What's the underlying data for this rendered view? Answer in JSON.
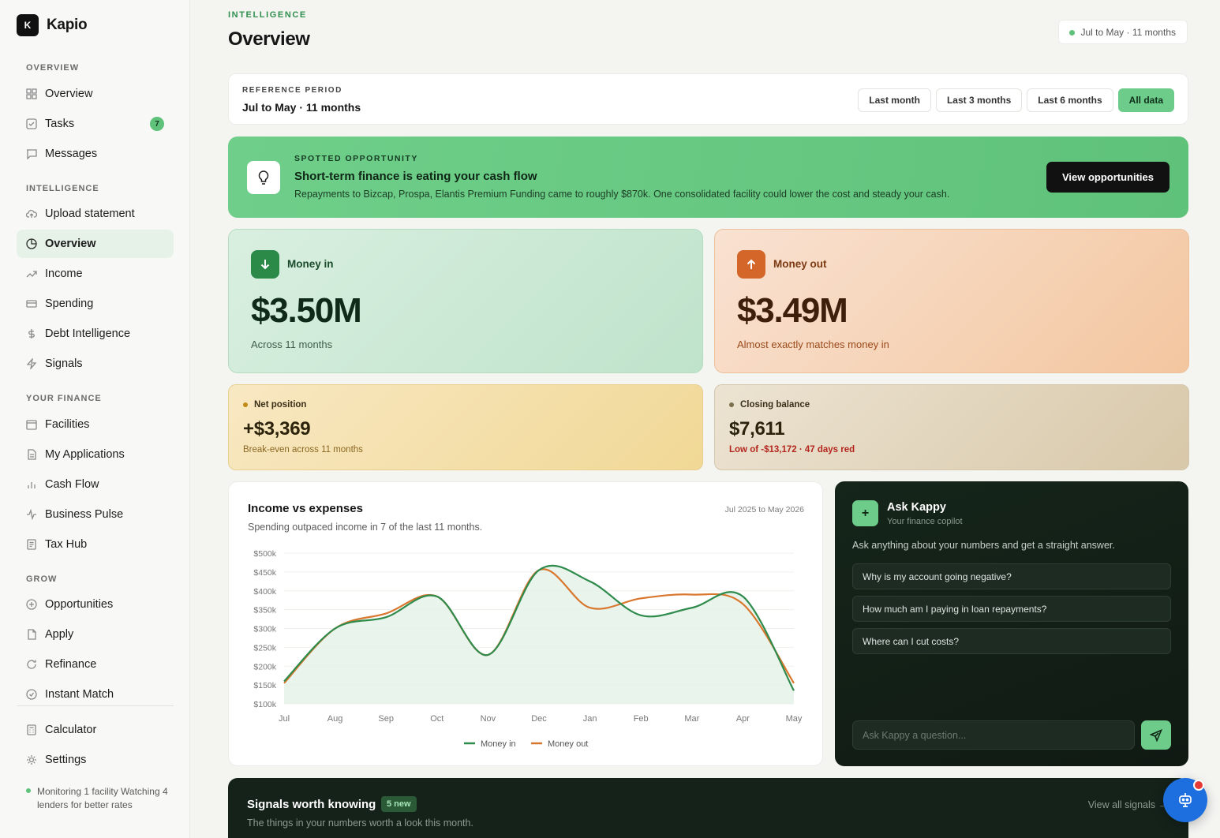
{
  "brand": {
    "logo_letter": "K",
    "name": "Kapio"
  },
  "sidebar": {
    "sections": {
      "overview": "OVERVIEW",
      "intelligence": "INTELLIGENCE",
      "your_finance": "YOUR FINANCE",
      "grow": "GROW"
    },
    "items": {
      "overview_top": "Overview",
      "tasks": "Tasks",
      "tasks_count": "7",
      "messages": "Messages",
      "upload": "Upload statement",
      "overview": "Overview",
      "income": "Income",
      "spending": "Spending",
      "debt": "Debt Intelligence",
      "signals": "Signals",
      "facilities": "Facilities",
      "applications": "My Applications",
      "cashflow": "Cash Flow",
      "pulse": "Business Pulse",
      "tax": "Tax Hub",
      "opportunities": "Opportunities",
      "apply": "Apply",
      "refinance": "Refinance",
      "instant": "Instant Match",
      "calculator": "Calculator",
      "settings": "Settings"
    },
    "monitoring": "Monitoring 1 facility Watching 4 lenders for better rates"
  },
  "header": {
    "eyebrow": "INTELLIGENCE",
    "title": "Overview",
    "period_pill": "Jul to May · 11 months"
  },
  "reference": {
    "label": "REFERENCE PERIOD",
    "value": "Jul to May · 11 months",
    "buttons": [
      "Last month",
      "Last 3 months",
      "Last 6 months",
      "All data"
    ],
    "selected": "All data"
  },
  "opportunity": {
    "eyebrow": "SPOTTED OPPORTUNITY",
    "title": "Short-term finance is eating your cash flow",
    "description": "Repayments to Bizcap, Prospa, Elantis Premium Funding came to roughly $870k. One consolidated facility could lower the cost and steady your cash.",
    "button": "View opportunities"
  },
  "money_in": {
    "label": "Money in",
    "value": "$3.50M",
    "sub": "Across 11 months"
  },
  "money_out": {
    "label": "Money out",
    "value": "$3.49M",
    "sub": "Almost exactly matches money in"
  },
  "net_position": {
    "label": "Net position",
    "value": "+$3,369",
    "sub": "Break-even across 11 months"
  },
  "closing_balance": {
    "label": "Closing balance",
    "value": "$7,611",
    "sub": "Low of -$13,172 · 47 days red"
  },
  "chart": {
    "title": "Income vs expenses",
    "range": "Jul 2025 to May 2026",
    "subtitle": "Spending outpaced income in 7 of the last 11 months."
  },
  "chart_data": {
    "type": "line",
    "categories": [
      "Jul",
      "Aug",
      "Sep",
      "Oct",
      "Nov",
      "Dec",
      "Jan",
      "Feb",
      "Mar",
      "Apr",
      "May"
    ],
    "yticks": [
      "$100k",
      "$150k",
      "$200k",
      "$250k",
      "$300k",
      "$350k",
      "$400k",
      "$450k",
      "$500k"
    ],
    "ylim": [
      100,
      500
    ],
    "series": [
      {
        "name": "Money in",
        "color": "#2e8b4c",
        "values": [
          160,
          300,
          330,
          385,
          230,
          455,
          425,
          335,
          355,
          385,
          135
        ]
      },
      {
        "name": "Money out",
        "color": "#d9772e",
        "values": [
          155,
          300,
          340,
          385,
          230,
          455,
          355,
          380,
          390,
          365,
          155
        ]
      }
    ],
    "legend": "bottom-center"
  },
  "kappy": {
    "title": "Ask Kappy",
    "subtitle": "Your finance copilot",
    "description": "Ask anything about your numbers and get a straight answer.",
    "questions": [
      "Why is my account going negative?",
      "How much am I paying in loan repayments?",
      "Where can I cut costs?"
    ],
    "placeholder": "Ask Kappy a question..."
  },
  "signals": {
    "title": "Signals worth knowing",
    "badge": "5 new",
    "subtitle": "The things in your numbers worth a look this month.",
    "link": "View all signals →"
  },
  "colors": {
    "accent": "#6dcc89",
    "money_in": "#2e8b4c",
    "money_out": "#d9772e"
  }
}
